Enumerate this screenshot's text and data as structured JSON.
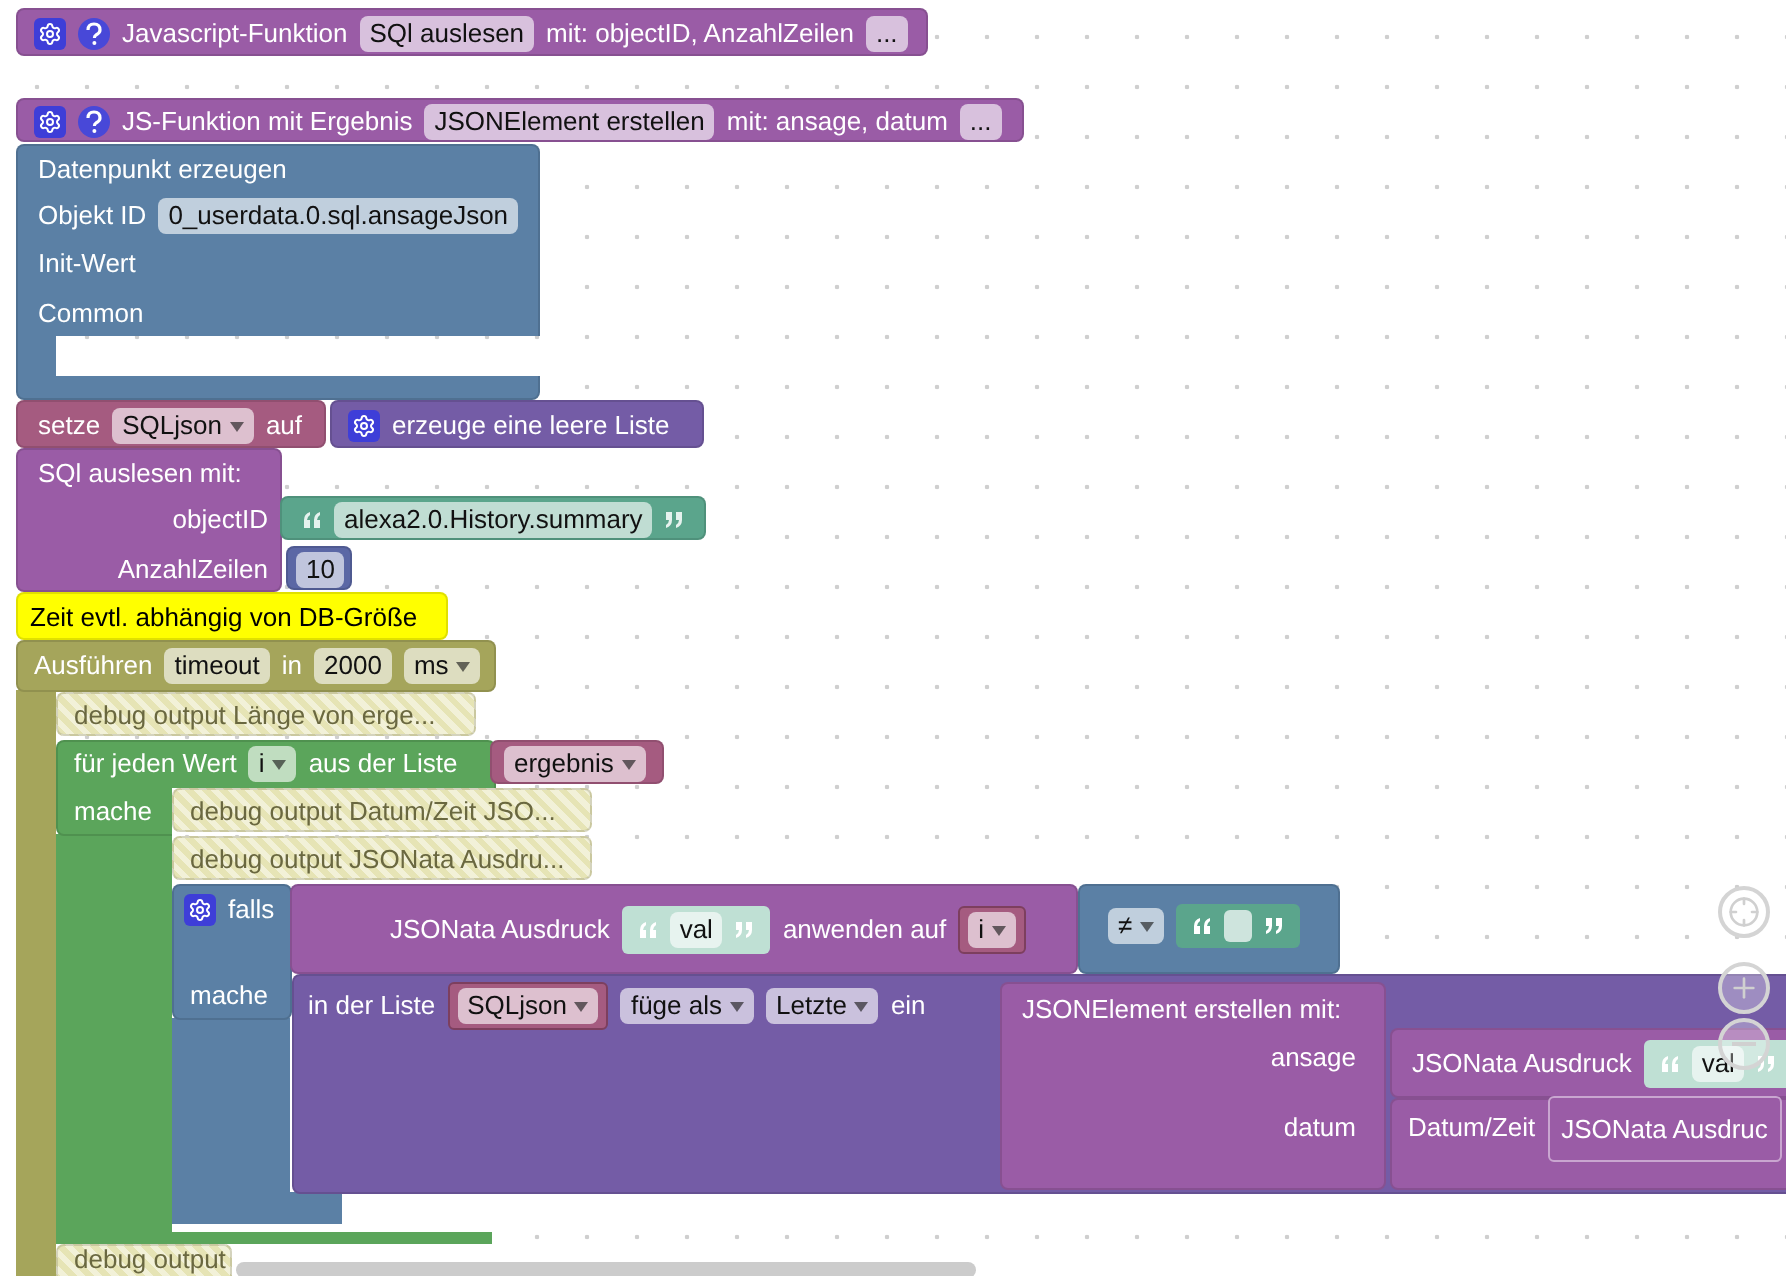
{
  "blocks": [
    {
      "kind": "function",
      "disabled": false,
      "rows": [
        [
          {
            "kind": "gear"
          },
          {
            "kind": "help"
          },
          {
            "kind": "text",
            "text": "Javascript-Funktion"
          },
          {
            "kind": "field",
            "text": "SQl auslesen"
          },
          {
            "kind": "text",
            "text": "mit: objectID, AnzahlZeilen"
          },
          {
            "kind": "field",
            "text": "..."
          }
        ]
      ]
    },
    {
      "kind": "function",
      "disabled": false,
      "rows": [
        [
          {
            "kind": "gear"
          },
          {
            "kind": "help"
          },
          {
            "kind": "text",
            "text": "JS-Funktion mit Ergebnis"
          },
          {
            "kind": "field",
            "text": "JSONElement erstellen"
          },
          {
            "kind": "text",
            "text": "mit: ansage, datum"
          },
          {
            "kind": "field",
            "text": "..."
          }
        ]
      ]
    },
    {
      "kind": "datapoint",
      "disabled": false,
      "rows": [
        [
          {
            "kind": "text",
            "text": "Datenpunkt erzeugen"
          }
        ],
        [
          {
            "kind": "text",
            "text": "Objekt ID"
          },
          {
            "kind": "field",
            "text": "0_userdata.0.sql.ansageJson"
          }
        ],
        [
          {
            "kind": "text",
            "text": "Init-Wert"
          }
        ],
        [
          {
            "kind": "text",
            "text": "Common"
          }
        ]
      ]
    },
    {
      "kind": "setvar",
      "disabled": false,
      "rows": [
        [
          {
            "kind": "text",
            "text": "setze"
          },
          {
            "kind": "dropdown",
            "text": "SQLjson"
          },
          {
            "kind": "text",
            "text": "auf"
          }
        ]
      ]
    },
    {
      "kind": "list",
      "disabled": false,
      "rows": [
        [
          {
            "kind": "gear"
          },
          {
            "kind": "text",
            "text": "erzeuge eine leere Liste"
          }
        ]
      ]
    },
    {
      "kind": "call",
      "disabled": false,
      "rows": [
        [
          {
            "kind": "text",
            "text": "SQl auslesen  mit:"
          }
        ],
        [
          {
            "kind": "text",
            "text": "objectID"
          }
        ],
        [
          {
            "kind": "text",
            "text": "AnzahlZeilen"
          }
        ]
      ]
    },
    {
      "kind": "string",
      "disabled": false,
      "rows": [
        [
          {
            "kind": "quote"
          },
          {
            "kind": "field",
            "text": "alexa2.0.History.summary"
          },
          {
            "kind": "quote"
          }
        ]
      ]
    },
    {
      "kind": "number",
      "disabled": false,
      "rows": [
        [
          {
            "kind": "field",
            "text": "10"
          }
        ]
      ]
    },
    {
      "kind": "comment",
      "disabled": false,
      "rows": [
        [
          {
            "kind": "text",
            "text": "Zeit evtl. abhängig von DB-Größe"
          }
        ]
      ]
    },
    {
      "kind": "timeout",
      "disabled": false,
      "rows": [
        [
          {
            "kind": "text",
            "text": "Ausführen"
          },
          {
            "kind": "field",
            "text": "timeout"
          },
          {
            "kind": "text",
            "text": "in"
          },
          {
            "kind": "field",
            "text": "2000"
          },
          {
            "kind": "dropdown",
            "text": "ms"
          }
        ]
      ]
    },
    {
      "kind": "debug",
      "disabled": true,
      "rows": [
        [
          {
            "kind": "text",
            "text": "debug output Länge von erge..."
          }
        ]
      ]
    },
    {
      "kind": "loop",
      "disabled": false,
      "rows": [
        [
          {
            "kind": "text",
            "text": "für jeden Wert"
          },
          {
            "kind": "dropdown",
            "text": "i"
          },
          {
            "kind": "text",
            "text": "aus der Liste"
          }
        ],
        [
          {
            "kind": "text",
            "text": "mache"
          }
        ]
      ]
    },
    {
      "kind": "variable",
      "disabled": false,
      "rows": [
        [
          {
            "kind": "dropdown",
            "text": "ergebnis"
          }
        ]
      ]
    },
    {
      "kind": "debug",
      "disabled": true,
      "rows": [
        [
          {
            "kind": "text",
            "text": "debug output Datum/Zeit JSO..."
          }
        ]
      ]
    },
    {
      "kind": "debug",
      "disabled": true,
      "rows": [
        [
          {
            "kind": "text",
            "text": "debug output JSONata Ausdru..."
          }
        ]
      ]
    },
    {
      "kind": "if",
      "disabled": false,
      "rows": [
        [
          {
            "kind": "gear"
          },
          {
            "kind": "text",
            "text": "falls"
          }
        ],
        [
          {
            "kind": "text",
            "text": "mache"
          }
        ]
      ]
    },
    {
      "kind": "call",
      "disabled": false,
      "rows": [
        [
          {
            "kind": "text",
            "text": "JSONata Ausdruck"
          },
          {
            "kind": "string",
            "text": "val"
          },
          {
            "kind": "text",
            "text": "anwenden auf"
          },
          {
            "kind": "var",
            "text": "i"
          }
        ]
      ]
    },
    {
      "kind": "if",
      "disabled": false,
      "rows": [
        [
          {
            "kind": "dropdown",
            "text": "≠"
          },
          {
            "kind": "string"
          }
        ]
      ]
    },
    {
      "kind": "list",
      "disabled": false,
      "rows": [
        [
          {
            "kind": "text",
            "text": "in der Liste"
          },
          {
            "kind": "var",
            "text": "SQLjson"
          },
          {
            "kind": "dropdown",
            "text": "füge als"
          },
          {
            "kind": "dropdown",
            "text": "Letzte"
          },
          {
            "kind": "text",
            "text": "ein"
          }
        ]
      ]
    },
    {
      "kind": "call",
      "disabled": false,
      "rows": [
        [
          {
            "kind": "text",
            "text": "JSONElement erstellen  mit:"
          }
        ],
        [
          {
            "kind": "text",
            "text": "ansage"
          }
        ],
        [
          {
            "kind": "text",
            "text": "datum"
          }
        ]
      ]
    },
    {
      "kind": "call",
      "disabled": false,
      "rows": [
        [
          {
            "kind": "text",
            "text": "JSONata Ausdruck"
          },
          {
            "kind": "string",
            "text": "val"
          }
        ]
      ]
    },
    {
      "kind": "call",
      "disabled": false,
      "rows": [
        [
          {
            "kind": "text",
            "text": "Datum/Zeit"
          },
          {
            "kind": "inner",
            "text": "JSONata Ausdruc"
          }
        ]
      ]
    },
    {
      "kind": "debug",
      "disabled": true,
      "rows": [
        [
          {
            "kind": "text",
            "text": "debug output"
          }
        ]
      ]
    }
  ]
}
